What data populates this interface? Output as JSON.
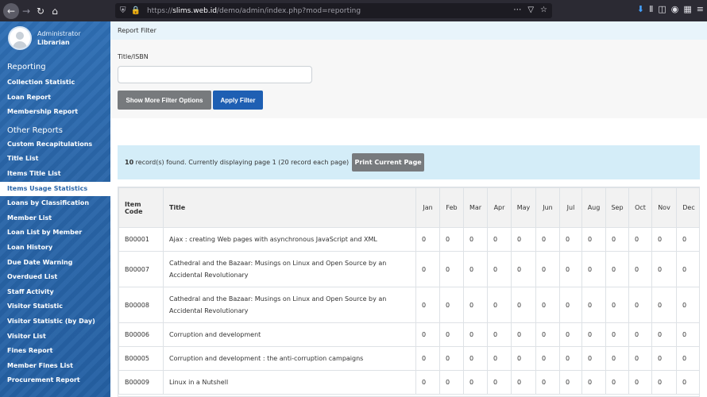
{
  "browser": {
    "url_prefix": "https://",
    "url_host": "slims.web.id",
    "url_path": "/demo/admin/index.php?mod=reporting"
  },
  "user": {
    "name": "Administrator",
    "role": "Librarian"
  },
  "sidebar": {
    "section1": "Reporting",
    "reporting_items": [
      "Collection Statistic",
      "Loan Report",
      "Membership Report"
    ],
    "section2": "Other Reports",
    "other_items": [
      "Custom Recapitulations",
      "Title List",
      "Items Title List",
      "Items Usage Statistics",
      "Loans by Classification",
      "Member List",
      "Loan List by Member",
      "Loan History",
      "Due Date Warning",
      "Overdued List",
      "Staff Activity",
      "Visitor Statistic",
      "Visitor Statistic (by Day)",
      "Visitor List",
      "Fines Report",
      "Member Fines List",
      "Procurement Report"
    ],
    "active_item": "Items Usage Statistics"
  },
  "breadcrumb": "Report Filter",
  "filter": {
    "label": "Title/ISBN",
    "value": "",
    "more_button": "Show More Filter Options",
    "apply_button": "Apply Filter"
  },
  "info": {
    "count": "10",
    "text": " record(s) found. Currently displaying page 1 (20 record each page)",
    "print_button": "Print Current Page"
  },
  "table": {
    "headers": [
      "Item Code",
      "Title",
      "Jan",
      "Feb",
      "Mar",
      "Apr",
      "May",
      "Jun",
      "Jul",
      "Aug",
      "Sep",
      "Oct",
      "Nov",
      "Dec"
    ],
    "rows": [
      {
        "code": "B00001",
        "title": "Ajax : creating Web pages with asynchronous JavaScript and XML",
        "months": [
          "0",
          "0",
          "0",
          "0",
          "0",
          "0",
          "0",
          "0",
          "0",
          "0",
          "0",
          "0"
        ]
      },
      {
        "code": "B00007",
        "title": "Cathedral and the Bazaar: Musings on Linux and Open Source by an Accidental Revolutionary",
        "months": [
          "0",
          "0",
          "0",
          "0",
          "0",
          "0",
          "0",
          "0",
          "0",
          "0",
          "0",
          "0"
        ]
      },
      {
        "code": "B00008",
        "title": "Cathedral and the Bazaar: Musings on Linux and Open Source by an Accidental Revolutionary",
        "months": [
          "0",
          "0",
          "0",
          "0",
          "0",
          "0",
          "0",
          "0",
          "0",
          "0",
          "0",
          "0"
        ]
      },
      {
        "code": "B00006",
        "title": "Corruption and development",
        "months": [
          "0",
          "0",
          "0",
          "0",
          "0",
          "0",
          "0",
          "0",
          "0",
          "0",
          "0",
          "0"
        ]
      },
      {
        "code": "B00005",
        "title": "Corruption and development : the anti-corruption campaigns",
        "months": [
          "0",
          "0",
          "0",
          "0",
          "0",
          "0",
          "0",
          "0",
          "0",
          "0",
          "0",
          "0"
        ]
      },
      {
        "code": "B00009",
        "title": "Linux in a Nutshell",
        "months": [
          "0",
          "0",
          "0",
          "0",
          "0",
          "0",
          "0",
          "0",
          "0",
          "0",
          "0",
          "0"
        ]
      }
    ]
  }
}
